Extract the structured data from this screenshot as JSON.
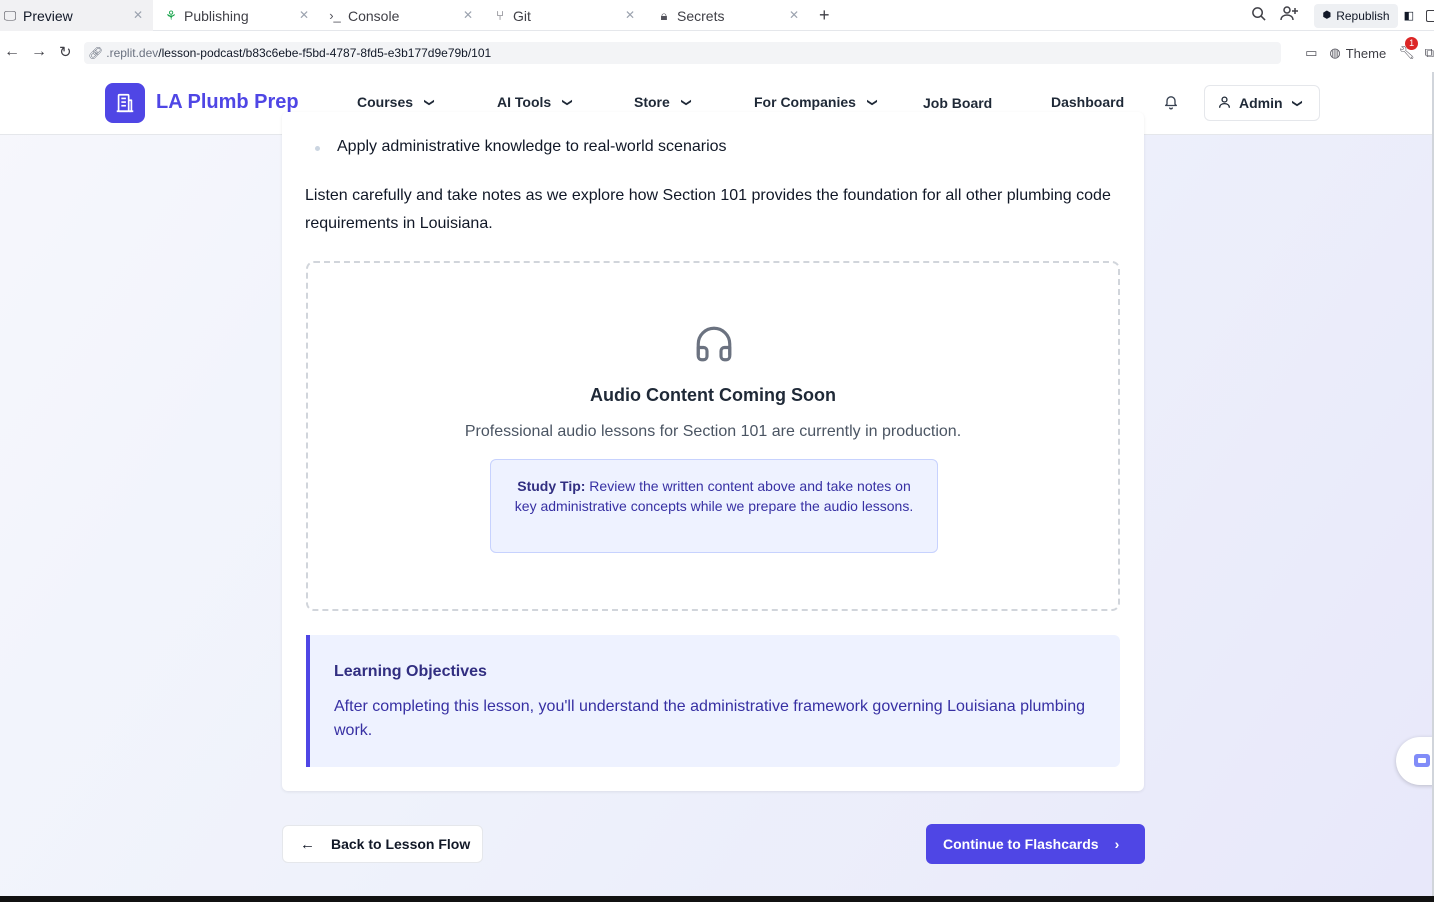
{
  "browser": {
    "tabs": [
      {
        "label": "Preview",
        "icon": "monitor-icon",
        "active": true
      },
      {
        "label": "Publishing",
        "icon": "publishing-icon"
      },
      {
        "label": "Console",
        "icon": "terminal-icon"
      },
      {
        "label": "Git",
        "icon": "git-icon"
      },
      {
        "label": "Secrets",
        "icon": "lock-icon"
      }
    ],
    "republish_label": "Republish",
    "url_domain": ".replit.dev",
    "url_path": "/lesson-podcast/b83c6ebe-f5bd-4787-8fd5-e3b177d9e79b/101",
    "theme_label": "Theme",
    "notification_count": "1"
  },
  "header": {
    "brand": "LA Plumb Prep",
    "nav": [
      "Courses",
      "AI Tools",
      "Store",
      "For Companies",
      "Job Board",
      "Dashboard"
    ],
    "admin_label": "Admin"
  },
  "lesson": {
    "bullet": "Apply administrative knowledge to real-world scenarios",
    "intro": "Listen carefully and take notes as we explore how Section 101 provides the foundation for all other plumbing code requirements in Louisiana.",
    "audio": {
      "title": "Audio Content Coming Soon",
      "description": "Professional audio lessons for Section 101 are currently in production.",
      "tip_label": "Study Tip:",
      "tip_text": " Review the written content above and take notes on key administrative concepts while we prepare the audio lessons."
    },
    "objectives": {
      "title": "Learning Objectives",
      "text": "After completing this lesson, you'll understand the administrative framework governing Louisiana plumbing work."
    }
  },
  "actions": {
    "back_label": "Back to Lesson Flow",
    "continue_label": "Continue to Flashcards"
  },
  "colors": {
    "accent": "#4f46e5",
    "tip_bg": "#eef2ff"
  }
}
